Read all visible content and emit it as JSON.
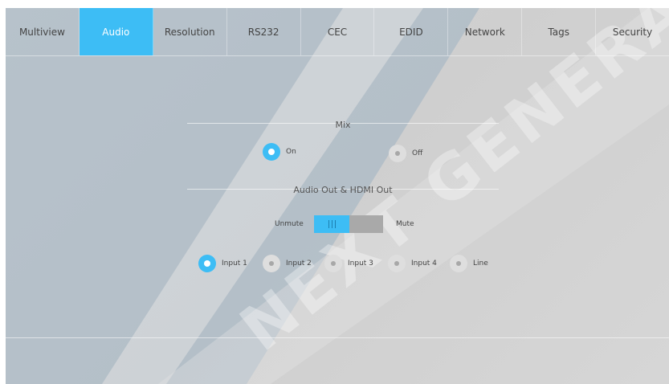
{
  "tabs": [
    "Multiview",
    "Audio",
    "Resolution",
    "RS232",
    "CEC",
    "EDID",
    "Network",
    "Tags",
    "Security"
  ],
  "active_tab": "Audio",
  "mix": {
    "title": "Mix",
    "on_label": "On",
    "off_label": "Off",
    "selected": "On"
  },
  "audio_out": {
    "title": "Audio Out & HDMI Out",
    "unmute_label": "Unmute",
    "mute_label": "Mute",
    "state": "Unmute"
  },
  "inputs": {
    "options": [
      "Input 1",
      "Input 2",
      "Input 3",
      "Input 4",
      "Line"
    ],
    "selected": "Input 1"
  },
  "colors": {
    "accent": "#3dbdf5",
    "background": "#d2d2d2",
    "toggle_off": "#a9a9a9"
  },
  "watermark_icon": "watermark-logo"
}
